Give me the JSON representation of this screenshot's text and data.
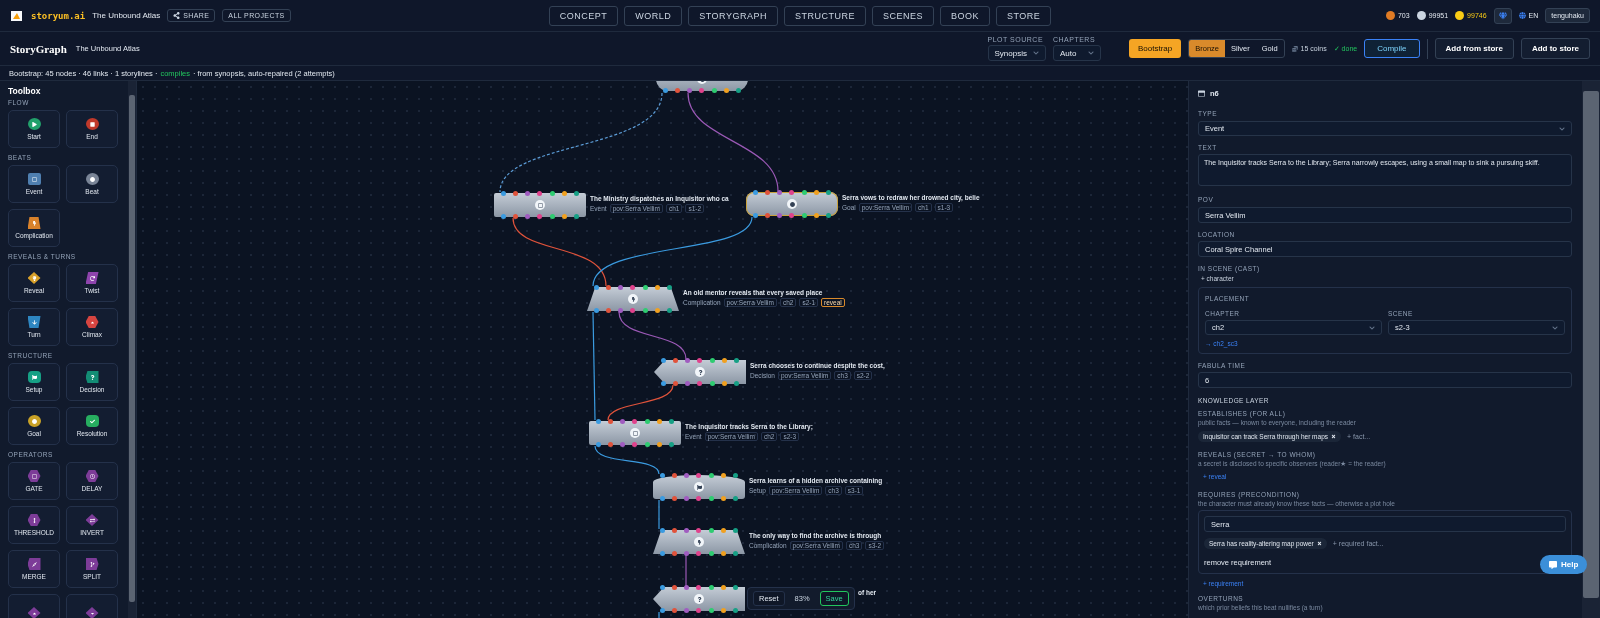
{
  "topbar": {
    "logo": "storyum.ai",
    "project": "The Unbound Atlas",
    "share": "SHARE",
    "all_projects": "ALL PROJECTS",
    "tabs": [
      {
        "label": "CONCEPT",
        "selected": false
      },
      {
        "label": "WORLD",
        "selected": false
      },
      {
        "label": "STORYGRAPH",
        "selected": false
      },
      {
        "label": "STRUCTURE",
        "selected": false
      },
      {
        "label": "SCENES",
        "selected": false
      },
      {
        "label": "BOOK",
        "selected": false
      },
      {
        "label": "STORE",
        "selected": false
      }
    ],
    "coins": [
      {
        "kind": "bronze",
        "amount": "703"
      },
      {
        "kind": "silver",
        "amount": "99951"
      },
      {
        "kind": "gold",
        "amount": "99746"
      }
    ],
    "language": "EN",
    "user": "tenguhaku"
  },
  "toolbar": {
    "title": "StoryGraph",
    "project": "The Unbound Atlas",
    "plot_source": {
      "label": "PLOT SOURCE",
      "value": "Synopsis"
    },
    "chapters": {
      "label": "CHAPTERS",
      "value": "Auto"
    },
    "bootstrap": "Bootstrap",
    "tiers": [
      {
        "label": "Bronze",
        "selected": true
      },
      {
        "label": "Silver",
        "selected": false
      },
      {
        "label": "Gold",
        "selected": false
      }
    ],
    "cost": "15 coins",
    "done": "✓ done",
    "compile": "Compile",
    "add_from_store": "Add from store",
    "add_to_store": "Add to store"
  },
  "status": {
    "summary": "Bootstrap: 45 nodes · 46 links · 1 storylines ·",
    "result": "compiles",
    "detail": "· from synopsis, auto-repaired (2 attempts)"
  },
  "toolbox": {
    "title": "Toolbox",
    "sections": [
      {
        "title": "FLOW",
        "tools": [
          {
            "kind": "start",
            "label": "Start"
          },
          {
            "kind": "end",
            "label": "End"
          }
        ]
      },
      {
        "title": "BEATS",
        "tools": [
          {
            "kind": "event",
            "label": "Event"
          },
          {
            "kind": "beat",
            "label": "Beat"
          },
          {
            "kind": "complication",
            "label": "Complication"
          }
        ]
      },
      {
        "title": "REVEALS & TURNS",
        "tools": [
          {
            "kind": "reveal",
            "label": "Reveal"
          },
          {
            "kind": "twist",
            "label": "Twist"
          },
          {
            "kind": "turn",
            "label": "Turn"
          },
          {
            "kind": "climax",
            "label": "Climax"
          }
        ]
      },
      {
        "title": "STRUCTURE",
        "tools": [
          {
            "kind": "setup",
            "label": "Setup"
          },
          {
            "kind": "decision",
            "label": "Decision"
          },
          {
            "kind": "goal",
            "label": "Goal"
          },
          {
            "kind": "resolution",
            "label": "Resolution"
          }
        ]
      },
      {
        "title": "OPERATORS",
        "tools": [
          {
            "kind": "gate",
            "label": "GATE"
          },
          {
            "kind": "delay",
            "label": "DELAY"
          },
          {
            "kind": "threshold",
            "label": "THRESHOLD"
          },
          {
            "kind": "invert",
            "label": "INVERT"
          },
          {
            "kind": "merge",
            "label": "MERGE"
          },
          {
            "kind": "split",
            "label": "SPLIT"
          },
          {
            "kind": "up"
          },
          {
            "kind": "down"
          }
        ]
      }
    ]
  },
  "graph": {
    "nodes": [
      {
        "kind": "round"
      },
      {
        "kind": "event",
        "title": "The Ministry dispatches an Inquisitor who ca",
        "type": "Event",
        "tags": [
          "pov:Serra Vellim",
          "ch1",
          "s1-2"
        ]
      },
      {
        "kind": "goal",
        "title": "Serra vows to redraw her drowned city, belie",
        "type": "Goal",
        "tags": [
          "pov:Serra Vellim",
          "ch1",
          "s1-3"
        ]
      },
      {
        "kind": "complication",
        "title": "An old mentor reveals that every saved place",
        "type": "Complication",
        "tags": [
          "pov:Serra Vellim",
          "ch2",
          "s2-1"
        ],
        "badge": "reveal"
      },
      {
        "kind": "decision",
        "title": "Serra chooses to continue despite the cost,",
        "type": "Decision",
        "tags": [
          "pov:Serra Vellim",
          "ch3",
          "s2-2"
        ]
      },
      {
        "kind": "event",
        "title": "The Inquisitor tracks Serra to the Library;",
        "type": "Event",
        "tags": [
          "pov:Serra Vellim",
          "ch2",
          "s2-3"
        ]
      },
      {
        "kind": "setup",
        "title": "Serra learns of a hidden archive containing",
        "type": "Setup",
        "tags": [
          "pov:Serra Vellim",
          "ch3",
          "s3-1"
        ]
      },
      {
        "kind": "complication",
        "title": "The only way to find the archive is through",
        "type": "Complication",
        "tags": [
          "pov:Serra Vellim",
          "ch3",
          "s3-2"
        ]
      },
      {
        "kind": "decision",
        "title": "of her"
      }
    ],
    "zoom": {
      "reset": "Reset",
      "level": "83%",
      "save": "Save"
    }
  },
  "inspector": {
    "node_id": "n6",
    "type": {
      "label": "TYPE",
      "value": "Event"
    },
    "text": {
      "label": "TEXT",
      "value": "The Inquisitor tracks Serra to the Library; Serra narrowly escapes, using a small map to sink a pursuing skiff."
    },
    "pov": {
      "label": "POV",
      "value": "Serra Vellim"
    },
    "location": {
      "label": "LOCATION",
      "value": "Coral Spire Channel"
    },
    "cast": {
      "label": "IN SCENE (CAST)",
      "add": "+ character"
    },
    "placement": {
      "title": "PLACEMENT",
      "chapter": {
        "label": "CHAPTER",
        "value": "ch2"
      },
      "scene": {
        "label": "SCENE",
        "value": "s2-3"
      },
      "link": "→ ch2_sc3"
    },
    "fabula": {
      "label": "FABULA TIME",
      "value": "6"
    },
    "knowledge_title": "KNOWLEDGE LAYER",
    "establishes": {
      "label": "ESTABLISHES (FOR ALL)",
      "hint": "public facts — known to everyone, including the reader",
      "facts": [
        "Inquisitor can track Serra through her maps"
      ],
      "placeholder": "+ fact..."
    },
    "reveals": {
      "label": "REVEALS (SECRET → TO WHOM)",
      "hint": "a secret is disclosed to specific observers (reader★ = the reader)",
      "add": "+ reveal"
    },
    "requires": {
      "label": "REQUIRES (PRECONDITION)",
      "hint": "the character must already know these facts — otherwise a plot hole",
      "character": "Serra",
      "facts": [
        "Serra has reality-altering map power"
      ],
      "placeholder": "+ required fact...",
      "remove": "remove requirement",
      "add": "+ requirement"
    },
    "overturns": {
      "label": "OVERTURNS",
      "hint": "which prior beliefs this beat nullifies (a turn)"
    }
  },
  "help": "Help"
}
